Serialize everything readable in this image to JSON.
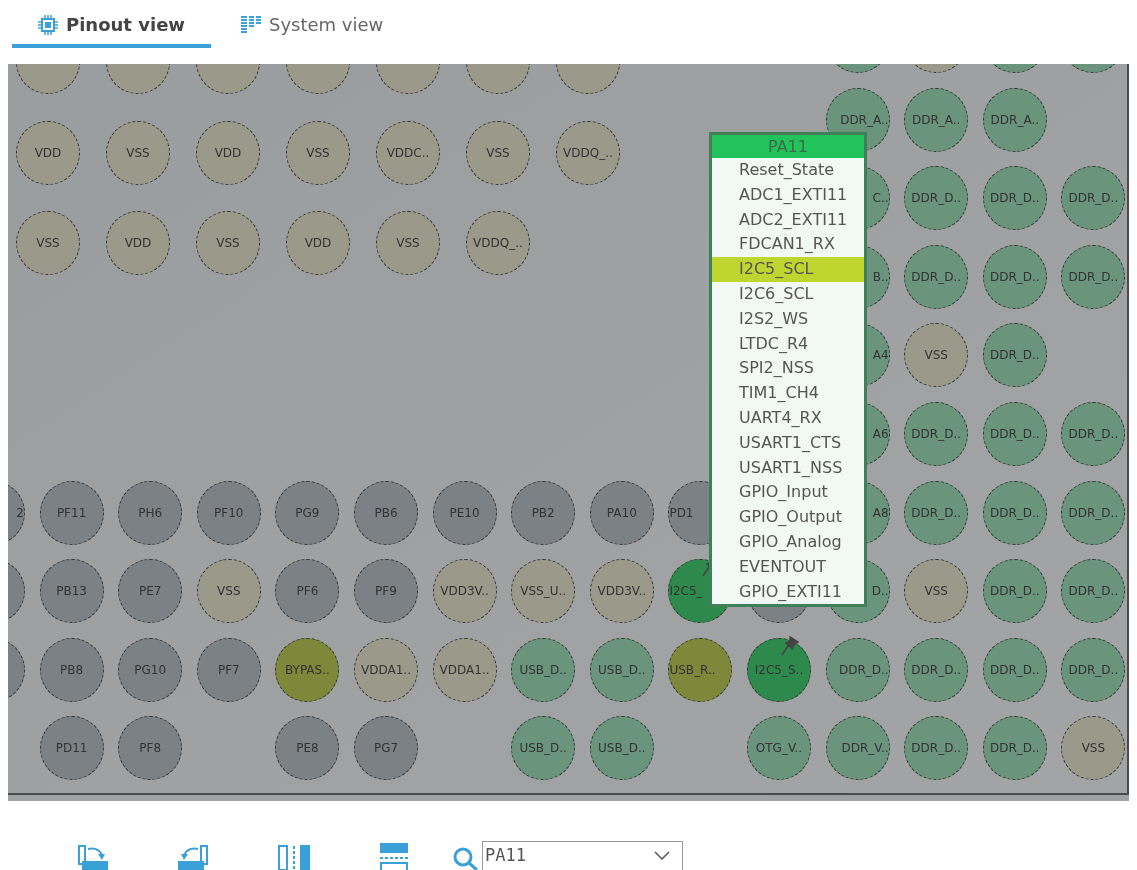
{
  "tabs": [
    {
      "label": "Pinout view",
      "selected": true
    },
    {
      "label": "System view",
      "selected": false
    }
  ],
  "power_block": {
    "rows": [
      [
        {
          "kind": "power",
          "pinned": false
        },
        {
          "kind": "power",
          "pinned": false
        },
        {
          "kind": "power",
          "pinned": false
        },
        {
          "kind": "power",
          "pinned": false
        },
        {
          "kind": "power",
          "pinned": false
        },
        {
          "kind": "power",
          "pinned": false
        },
        {
          "kind": "power",
          "pinned": false
        }
      ],
      [
        {
          "label": "VDD",
          "kind": "power",
          "pinned": false
        },
        {
          "label": "VSS",
          "kind": "power",
          "pinned": false
        },
        {
          "label": "VDD",
          "kind": "power",
          "pinned": false
        },
        {
          "label": "VSS",
          "kind": "power",
          "pinned": false
        },
        {
          "label": "VDDC..",
          "kind": "power",
          "pinned": false
        },
        {
          "label": "VSS",
          "kind": "power",
          "pinned": false
        },
        {
          "label": "VDDQ_..",
          "kind": "power",
          "pinned": false
        }
      ],
      [
        {
          "label": "VSS",
          "kind": "power",
          "pinned": false
        },
        {
          "label": "VDD",
          "kind": "power",
          "pinned": false
        },
        {
          "label": "VSS",
          "kind": "power",
          "pinned": false
        },
        {
          "label": "VDD",
          "kind": "power",
          "pinned": false
        },
        {
          "label": "VSS",
          "kind": "power",
          "pinned": false
        },
        {
          "label": "VDDQ_..",
          "kind": "power",
          "pinned": false
        }
      ]
    ]
  },
  "ball_grid": {
    "rows": [
      [
        null,
        null,
        null,
        null,
        null,
        null,
        null,
        null,
        null,
        null,
        null,
        {
          "kind": "ddr",
          "pinned": false
        },
        {
          "kind": "power",
          "pinned": false
        },
        {
          "kind": "ddr",
          "pinned": false
        },
        {
          "kind": "ddr",
          "pinned": false
        }
      ],
      [
        null,
        null,
        null,
        null,
        null,
        null,
        null,
        null,
        null,
        null,
        null,
        {
          "label": "DDR_A..",
          "kind": "ddr",
          "pinned": false
        },
        {
          "label": "DDR_A..",
          "kind": "ddr",
          "pinned": false
        },
        {
          "label": "DDR_A..",
          "kind": "ddr",
          "pinned": false
        },
        null
      ],
      [
        null,
        null,
        null,
        null,
        null,
        null,
        null,
        null,
        null,
        null,
        null,
        {
          "label": "C..",
          "kind": "ddr",
          "pinned": false
        },
        {
          "label": "DDR_D..",
          "kind": "ddr",
          "pinned": false
        },
        {
          "label": "DDR_D..",
          "kind": "ddr",
          "pinned": false
        },
        {
          "label": "DDR_D..",
          "kind": "ddr",
          "pinned": false
        }
      ],
      [
        null,
        null,
        null,
        null,
        null,
        null,
        null,
        null,
        null,
        null,
        null,
        {
          "label": "B..",
          "kind": "ddr",
          "pinned": false
        },
        {
          "label": "DDR_D..",
          "kind": "ddr",
          "pinned": false
        },
        {
          "label": "DDR_D..",
          "kind": "ddr",
          "pinned": false
        },
        {
          "label": "DDR_D..",
          "kind": "ddr",
          "pinned": false
        }
      ],
      [
        null,
        null,
        null,
        null,
        null,
        null,
        null,
        null,
        null,
        null,
        null,
        {
          "label": "A4",
          "kind": "ddr",
          "pinned": false
        },
        {
          "label": "VSS",
          "kind": "power",
          "pinned": false
        },
        {
          "label": "DDR_D..",
          "kind": "ddr",
          "pinned": false
        },
        null
      ],
      [
        null,
        null,
        null,
        null,
        null,
        null,
        null,
        null,
        null,
        null,
        null,
        {
          "label": "A6",
          "kind": "ddr",
          "pinned": false
        },
        {
          "label": "DDR_D..",
          "kind": "ddr",
          "pinned": false
        },
        {
          "label": "DDR_D..",
          "kind": "ddr",
          "pinned": false
        },
        {
          "label": "DDR_D..",
          "kind": "ddr",
          "pinned": false
        }
      ],
      [
        {
          "label": "2",
          "kind": "io",
          "pinned": false
        },
        {
          "label": "PF11",
          "kind": "io",
          "pinned": false
        },
        {
          "label": "PH6",
          "kind": "io",
          "pinned": false
        },
        {
          "label": "PF10",
          "kind": "io",
          "pinned": false
        },
        {
          "label": "PG9",
          "kind": "io",
          "pinned": false
        },
        {
          "label": "PB6",
          "kind": "io",
          "pinned": false
        },
        {
          "label": "PE10",
          "kind": "io",
          "pinned": false
        },
        {
          "label": "PB2",
          "kind": "io",
          "pinned": false
        },
        {
          "label": "PA10",
          "kind": "io",
          "pinned": false
        },
        {
          "label": "PD1",
          "kind": "io",
          "pinned": false
        },
        null,
        {
          "label": "A8",
          "kind": "ddr",
          "pinned": false
        },
        {
          "label": "DDR_D..",
          "kind": "ddr",
          "pinned": false
        },
        {
          "label": "DDR_D..",
          "kind": "ddr",
          "pinned": false
        },
        {
          "label": "DDR_D..",
          "kind": "ddr",
          "pinned": false
        }
      ],
      [
        {
          "kind": "io",
          "pinned": false
        },
        {
          "label": "PB13",
          "kind": "io",
          "pinned": false
        },
        {
          "label": "PE7",
          "kind": "io",
          "pinned": false
        },
        {
          "label": "VSS",
          "kind": "power",
          "pinned": false
        },
        {
          "label": "PF6",
          "kind": "io",
          "pinned": false
        },
        {
          "label": "PF9",
          "kind": "io",
          "pinned": false
        },
        {
          "label": "VDD3V..",
          "kind": "power",
          "pinned": false
        },
        {
          "label": "VSS_U..",
          "kind": "power",
          "pinned": false
        },
        {
          "label": "VDD3V..",
          "kind": "power",
          "pinned": false
        },
        {
          "label": "I2C5_",
          "kind": "assigned",
          "pinned": true
        },
        {
          "kind": "io",
          "pinned": false
        },
        {
          "label": "D..",
          "kind": "ddr",
          "pinned": false
        },
        {
          "label": "VSS",
          "kind": "power",
          "pinned": false
        },
        {
          "label": "DDR_D..",
          "kind": "ddr",
          "pinned": false
        },
        {
          "label": "DDR_D..",
          "kind": "ddr",
          "pinned": false
        }
      ],
      [
        {
          "kind": "io",
          "pinned": false
        },
        {
          "label": "PB8",
          "kind": "io",
          "pinned": false
        },
        {
          "label": "PG10",
          "kind": "io",
          "pinned": false
        },
        {
          "label": "PF7",
          "kind": "io",
          "pinned": false
        },
        {
          "label": "BYPAS..",
          "kind": "special",
          "pinned": false
        },
        {
          "label": "VDDA1..",
          "kind": "power",
          "pinned": false
        },
        {
          "label": "VDDA1..",
          "kind": "power",
          "pinned": false
        },
        {
          "label": "USB_D..",
          "kind": "ddr",
          "pinned": false
        },
        {
          "label": "USB_D..",
          "kind": "ddr",
          "pinned": false
        },
        {
          "label": "USB_R..",
          "kind": "special",
          "pinned": false
        },
        {
          "label": "I2C5_S..",
          "kind": "assigned",
          "pinned": true
        },
        {
          "label": "DDR_D..",
          "kind": "ddr",
          "pinned": false
        },
        {
          "label": "DDR_D..",
          "kind": "ddr",
          "pinned": false
        },
        {
          "label": "DDR_D..",
          "kind": "ddr",
          "pinned": false
        },
        {
          "label": "DDR_D..",
          "kind": "ddr",
          "pinned": false
        }
      ],
      [
        null,
        {
          "label": "PD11",
          "kind": "io",
          "pinned": false
        },
        {
          "label": "PF8",
          "kind": "io",
          "pinned": false
        },
        null,
        {
          "label": "PE8",
          "kind": "io",
          "pinned": false
        },
        {
          "label": "PG7",
          "kind": "io",
          "pinned": false
        },
        null,
        {
          "label": "USB_D..",
          "kind": "ddr",
          "pinned": false
        },
        {
          "label": "USB_D..",
          "kind": "ddr",
          "pinned": false
        },
        null,
        {
          "label": "OTG_V..",
          "kind": "ddr",
          "pinned": false
        },
        {
          "label": "DDR_V..",
          "kind": "ddr",
          "pinned": false
        },
        {
          "label": "DDR_D..",
          "kind": "ddr",
          "pinned": false
        },
        {
          "label": "DDR_D..",
          "kind": "ddr",
          "pinned": false
        },
        {
          "label": "VSS",
          "kind": "power",
          "pinned": false
        }
      ]
    ]
  },
  "pin_menu": {
    "title": "PA11",
    "items": [
      {
        "label": "Reset_State",
        "selected": false
      },
      {
        "label": "ADC1_EXTI11",
        "selected": false
      },
      {
        "label": "ADC2_EXTI11",
        "selected": false
      },
      {
        "label": "FDCAN1_RX",
        "selected": false
      },
      {
        "label": "I2C5_SCL",
        "selected": true
      },
      {
        "label": "I2C6_SCL",
        "selected": false
      },
      {
        "label": "I2S2_WS",
        "selected": false
      },
      {
        "label": "LTDC_R4",
        "selected": false
      },
      {
        "label": "SPI2_NSS",
        "selected": false
      },
      {
        "label": "TIM1_CH4",
        "selected": false
      },
      {
        "label": "UART4_RX",
        "selected": false
      },
      {
        "label": "USART1_CTS",
        "selected": false
      },
      {
        "label": "USART1_NSS",
        "selected": false
      },
      {
        "label": "GPIO_Input",
        "selected": false
      },
      {
        "label": "GPIO_Output",
        "selected": false
      },
      {
        "label": "GPIO_Analog",
        "selected": false
      },
      {
        "label": "EVENTOUT",
        "selected": false
      },
      {
        "label": "GPIO_EXTI11",
        "selected": false
      }
    ]
  },
  "search": {
    "value": "PA11"
  }
}
